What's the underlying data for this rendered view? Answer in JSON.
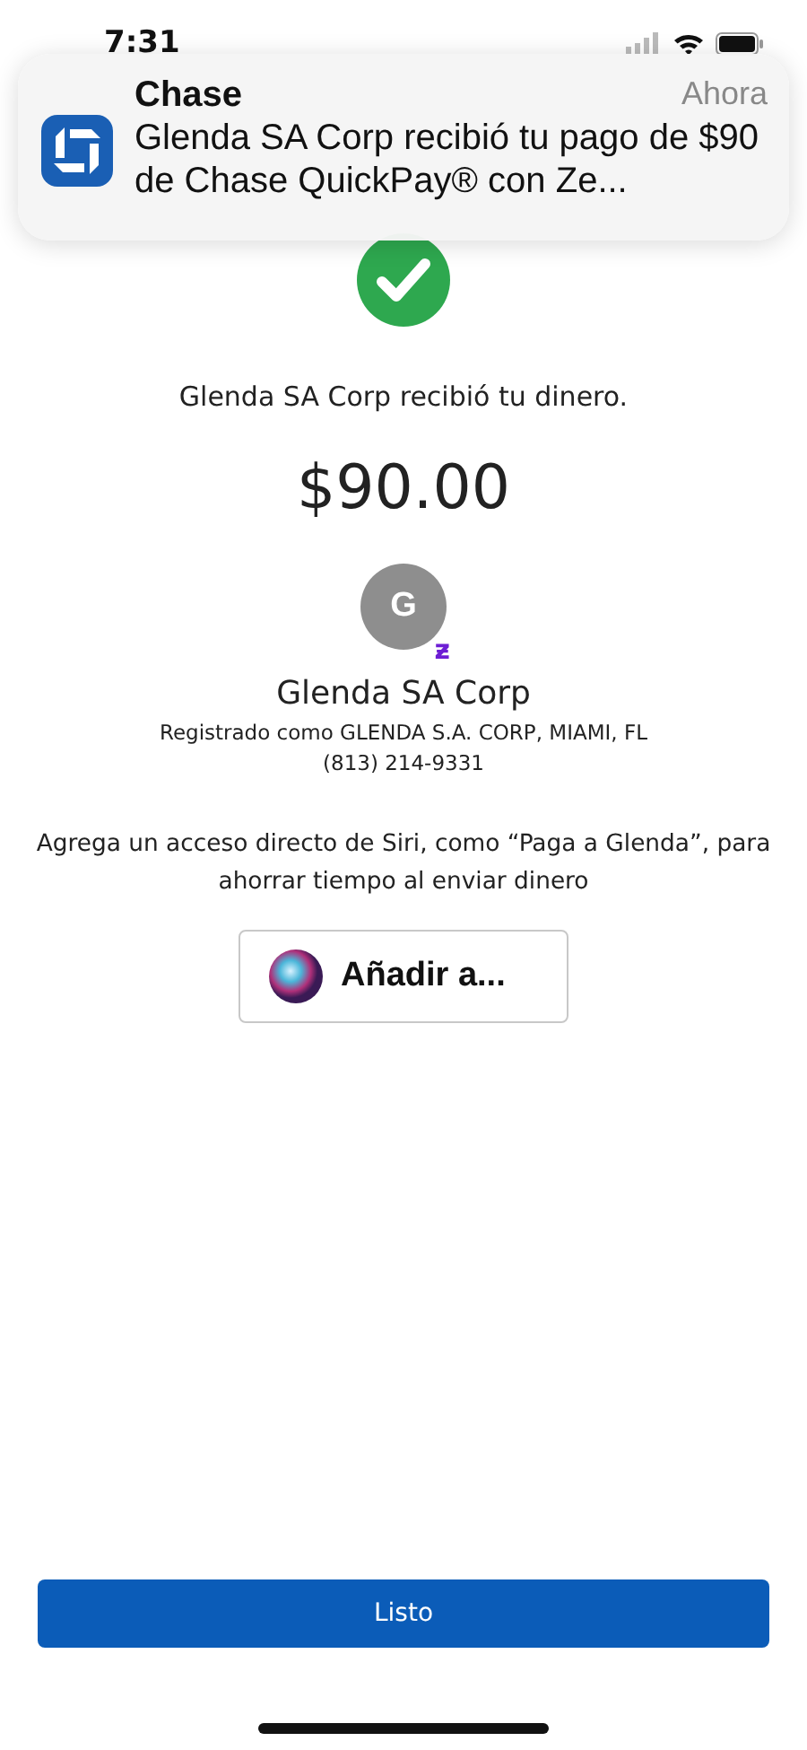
{
  "status_bar": {
    "time": "7:31"
  },
  "notification": {
    "app": "Chase",
    "time": "Ahora",
    "message": "Glenda SA Corp recibió tu pago de $90 de Chase QuickPay® con Ze..."
  },
  "confirmation": {
    "message": "Glenda SA Corp recibió tu dinero.",
    "amount": "$90.00"
  },
  "recipient": {
    "initial": "G",
    "badge": "ƶ",
    "name": "Glenda SA Corp",
    "registered": "Registrado como GLENDA S.A. CORP, MIAMI, FL",
    "phone": "(813) 214-9331"
  },
  "siri": {
    "hint": "Agrega un acceso directo de Siri, como “Paga a Glenda”, para ahorrar tiempo al enviar dinero",
    "button": "Añadir a..."
  },
  "done_button": "Listo"
}
